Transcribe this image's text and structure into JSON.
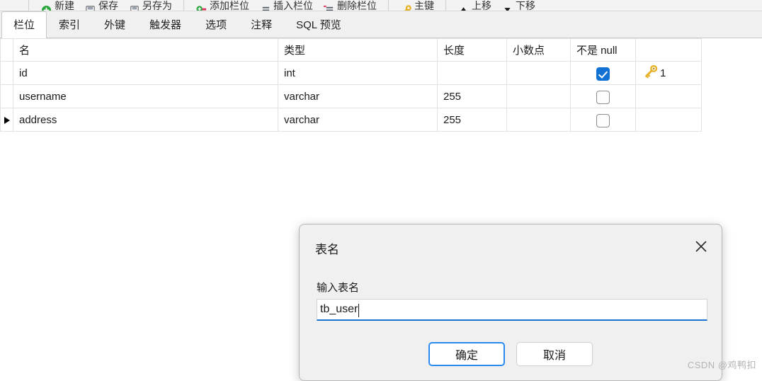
{
  "toolbar": {
    "menu_icon": "hamburger-icon",
    "groups": [
      {
        "items": [
          {
            "icon": "new-icon",
            "label": "新建"
          },
          {
            "icon": "save-icon",
            "label": "保存"
          },
          {
            "icon": "save-as-icon",
            "label": "另存为"
          }
        ]
      },
      {
        "items": [
          {
            "icon": "add-field-icon",
            "label": "添加栏位"
          },
          {
            "icon": "insert-field-icon",
            "label": "插入栏位"
          },
          {
            "icon": "delete-field-icon",
            "label": "删除栏位"
          }
        ]
      },
      {
        "items": [
          {
            "icon": "primary-key-icon",
            "label": "主键"
          }
        ]
      },
      {
        "items": [
          {
            "icon": "move-up-icon",
            "label": "上移"
          },
          {
            "icon": "move-down-icon",
            "label": "下移"
          }
        ]
      }
    ]
  },
  "tabs": [
    {
      "label": "栏位",
      "active": true
    },
    {
      "label": "索引",
      "active": false
    },
    {
      "label": "外键",
      "active": false
    },
    {
      "label": "触发器",
      "active": false
    },
    {
      "label": "选项",
      "active": false
    },
    {
      "label": "注释",
      "active": false
    },
    {
      "label": "SQL 预览",
      "active": false
    }
  ],
  "grid": {
    "columns": [
      "名",
      "类型",
      "长度",
      "小数点",
      "不是 null",
      ""
    ],
    "rows": [
      {
        "selected": false,
        "name": "id",
        "type": "int",
        "length": "",
        "decimals": "",
        "not_null": true,
        "key_icon": "key-icon",
        "key_order": "1"
      },
      {
        "selected": false,
        "name": "username",
        "type": "varchar",
        "length": "255",
        "decimals": "",
        "not_null": false,
        "key_icon": "",
        "key_order": ""
      },
      {
        "selected": true,
        "name": "address",
        "type": "varchar",
        "length": "255",
        "decimals": "",
        "not_null": false,
        "key_icon": "",
        "key_order": ""
      }
    ]
  },
  "dialog": {
    "title": "表名",
    "close_icon": "close-icon",
    "field_label": "输入表名",
    "input_value": "tb_user",
    "input_placeholder": "",
    "confirm_label": "确定",
    "cancel_label": "取消",
    "accent_color": "#1872d0"
  },
  "watermark": "CSDN @鸡鸭扣"
}
